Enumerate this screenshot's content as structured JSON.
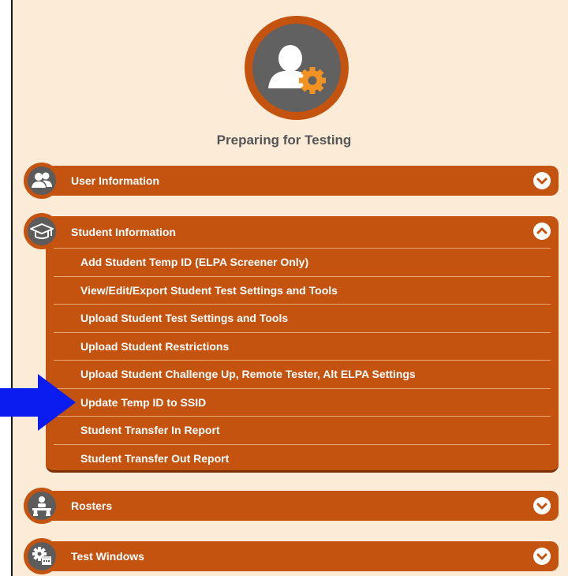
{
  "page": {
    "title": "Preparing for Testing",
    "avatar_icon": "user-gear-icon"
  },
  "sections": [
    {
      "label": "User Information",
      "icon": "users-icon",
      "state": "collapsed"
    },
    {
      "label": "Student Information",
      "icon": "graduation-cap-icon",
      "state": "expanded",
      "items": [
        "Add Student Temp ID (ELPA Screener Only)",
        "View/Edit/Export Student Test Settings and Tools",
        "Upload Student Test Settings and Tools",
        "Upload Student Restrictions",
        "Upload Student Challenge Up, Remote Tester, Alt ELPA Settings",
        "Update Temp ID to SSID",
        "Student Transfer In Report",
        "Student Transfer Out Report"
      ]
    },
    {
      "label": "Rosters",
      "icon": "classroom-icon",
      "state": "collapsed"
    },
    {
      "label": "Test Windows",
      "icon": "gear-calendar-icon",
      "state": "collapsed"
    }
  ],
  "annotation": {
    "icon": "right-arrow-icon",
    "color": "#0a1cf0",
    "points_to_item": "Update Temp ID to SSID"
  },
  "colors": {
    "accent": "#c4530f",
    "background": "#fcebd6",
    "icon_gray": "#616161"
  }
}
